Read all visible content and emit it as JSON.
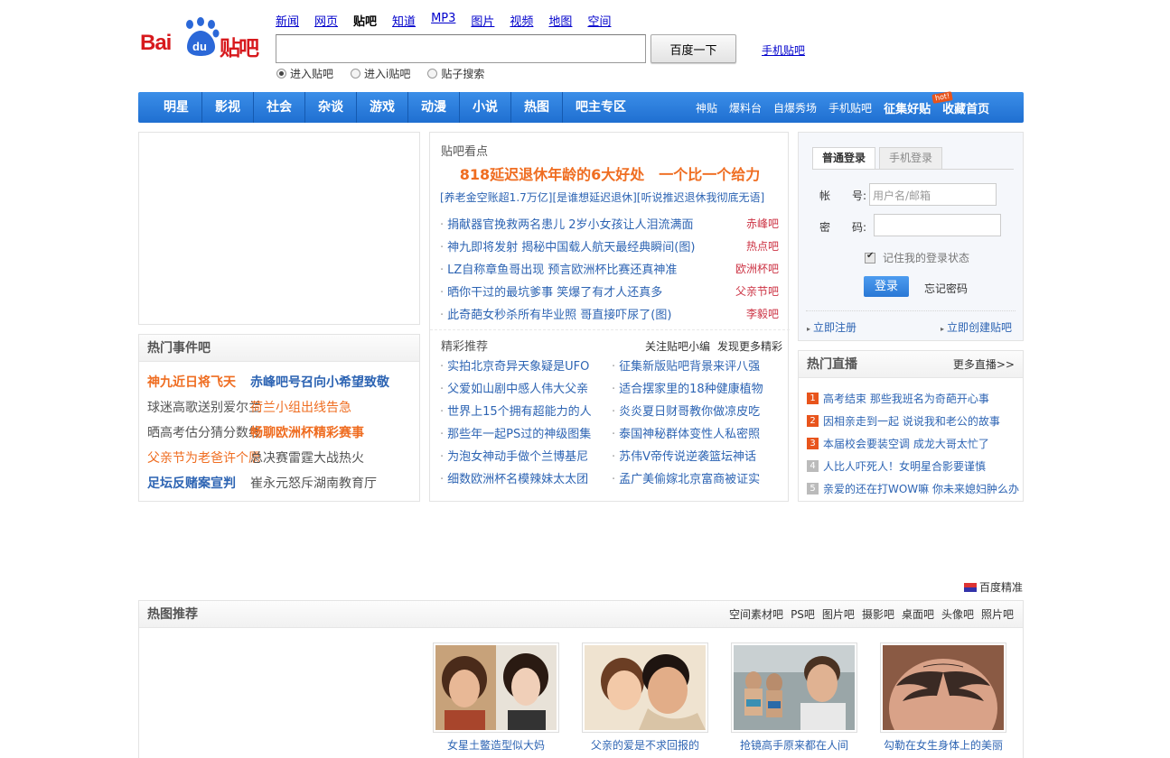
{
  "header": {
    "logo_text_bai": "Bai",
    "logo_text_du": "du",
    "logo_text_tieba": "贴吧",
    "top_nav": [
      {
        "label": "新闻",
        "current": false
      },
      {
        "label": "网页",
        "current": false
      },
      {
        "label": "贴吧",
        "current": true
      },
      {
        "label": "知道",
        "current": false
      },
      {
        "label": "MP3",
        "current": false
      },
      {
        "label": "图片",
        "current": false
      },
      {
        "label": "视频",
        "current": false
      },
      {
        "label": "地图",
        "current": false
      },
      {
        "label": "空间",
        "current": false
      }
    ],
    "search_value": "",
    "search_button": "百度一下",
    "mobile_link": "手机贴吧",
    "radios": [
      {
        "label": "进入贴吧",
        "checked": true
      },
      {
        "label": "进入i贴吧",
        "checked": false
      },
      {
        "label": "贴子搜索",
        "checked": false
      }
    ]
  },
  "navbar": {
    "main": [
      "明星",
      "影视",
      "社会",
      "杂谈",
      "游戏",
      "动漫",
      "小说",
      "热图",
      "吧主专区"
    ],
    "right": [
      "神贴",
      "爆料台",
      "自爆秀场",
      "手机贴吧",
      "征集好贴",
      "收藏首页"
    ],
    "hot_badge": "hot!"
  },
  "hot_events": {
    "title": "热门事件吧",
    "rows": [
      [
        "神九近日将飞天",
        "赤峰吧号召向小希望致敬"
      ],
      [
        "球迷高歌送别爱尔兰",
        "荷兰小组出线告急"
      ],
      [
        "晒高考估分猜分数线",
        "畅聊欧洲杯精彩赛事"
      ],
      [
        "父亲节为老爸许个愿",
        "总决赛雷霆大战热火"
      ],
      [
        "足坛反赌案宣判",
        "崔永元怒斥湖南教育厅"
      ]
    ]
  },
  "tieba_news": {
    "title": "贴吧看点",
    "headline": "818延迟退休年龄的6大好处　一个比一个给力",
    "sub_links": "[养老金空账超1.7万亿][是谁想延迟退休][听说推迟退休我彻底无语]",
    "items": [
      {
        "text": "捐献器官挽救两名患儿  2岁小女孩让人泪流满面",
        "tag": "赤峰吧"
      },
      {
        "text": "神九即将发射  揭秘中国载人航天最经典瞬间(图)",
        "tag": "热点吧"
      },
      {
        "text": "LZ自称章鱼哥出现  预言欧洲杯比赛还真神准",
        "tag": "欧洲杯吧"
      },
      {
        "text": "晒你干过的最坑爹事  笑爆了有才人还真多",
        "tag": "父亲节吧"
      },
      {
        "text": "此奇葩女秒杀所有毕业照  哥直接吓尿了(图)",
        "tag": "李毅吧"
      }
    ],
    "rec_title": "精彩推荐",
    "rec_links": [
      "关注贴吧小编",
      "发现更多精彩"
    ],
    "rec_items": [
      "实拍北京奇异天象疑是UFO",
      "征集新版贴吧背景来评八强",
      "父爱如山剧中感人伟大父亲",
      "适合摆家里的18种健康植物",
      "世界上15个拥有超能力的人",
      "炎炎夏日财哥教你做凉皮吃",
      "那些年一起PS过的神级图集",
      "泰国神秘群体变性人私密照",
      "为泡女神动手做个兰博基尼",
      "苏伟V帝传说逆袭篮坛神话",
      "细数欧洲杯名模辣妹太太团",
      "孟广美偷嫁北京富商被证实"
    ]
  },
  "login": {
    "tabs": [
      "普通登录",
      "手机登录"
    ],
    "account_label": "帐　　号:",
    "account_placeholder": "用户名/邮箱",
    "password_label": "密　　码:",
    "remember": "记住我的登录状态",
    "login_button": "登录",
    "forgot": "忘记密码",
    "register": "立即注册",
    "create_tieba": "立即创建贴吧"
  },
  "live": {
    "title": "热门直播",
    "more": "更多直播>>",
    "items": [
      {
        "num": "1",
        "text": "高考结束  那些我班名为奇葩开心事",
        "color": "#e8541c"
      },
      {
        "num": "2",
        "text": "因相亲走到一起  说说我和老公的故事",
        "color": "#e8541c"
      },
      {
        "num": "3",
        "text": "本届校会要装空调  成龙大哥太忙了",
        "color": "#e8541c"
      },
      {
        "num": "4",
        "text": "人比人吓死人！女明星合影要谨慎",
        "color": "#bbbbbb"
      },
      {
        "num": "5",
        "text": "亲爱的还在打WOW嘛  你未来媳妇肿么办",
        "color": "#bbbbbb"
      }
    ]
  },
  "baidu_ad": "百度精准",
  "hot_images": {
    "title": "热图推荐",
    "links": [
      "空间素材吧",
      "PS吧",
      "图片吧",
      "摄影吧",
      "桌面吧",
      "头像吧",
      "照片吧"
    ],
    "thumbs": [
      {
        "caption": "女星土鳖造型似大妈"
      },
      {
        "caption": "父亲的爱是不求回报的"
      },
      {
        "caption": "抢镜高手原来都在人间"
      },
      {
        "caption": "勾勒在女生身体上的美丽"
      }
    ]
  },
  "colors": {
    "brand_red": "#d7191d",
    "nav_blue": "#2a7ddb",
    "link_blue": "#2d64b3",
    "highlight_orange": "#ef6d21"
  }
}
